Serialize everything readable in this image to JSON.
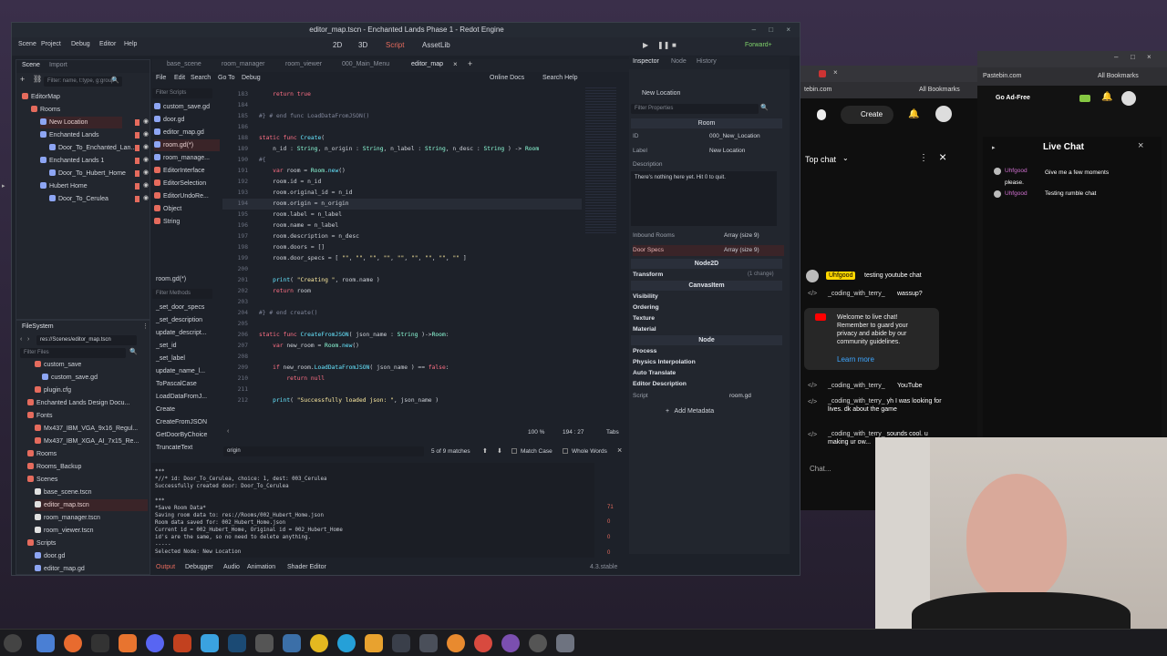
{
  "window": {
    "title": "editor_map.tscn - Enchanted Lands Phase 1 - Redot Engine"
  },
  "menu": [
    "Scene",
    "Project",
    "Debug",
    "Editor",
    "Help"
  ],
  "workspaces": [
    "2D",
    "3D",
    "Script",
    "AssetLib"
  ],
  "renderer": "Forward+",
  "scene_panel": {
    "tabs": [
      "Scene",
      "Import"
    ],
    "filter_placeholder": "Filter: name, t:type, g:group",
    "tree": [
      {
        "label": "EditorMap",
        "depth": 0
      },
      {
        "label": "Rooms",
        "depth": 1
      },
      {
        "label": "New Location",
        "depth": 2,
        "selected": true
      },
      {
        "label": "Enchanted Lands",
        "depth": 2
      },
      {
        "label": "Door_To_Enchanted_Lan...",
        "depth": 3
      },
      {
        "label": "Enchanted Lands 1",
        "depth": 2
      },
      {
        "label": "Door_To_Hubert_Home",
        "depth": 3
      },
      {
        "label": "Hubert Home",
        "depth": 2
      },
      {
        "label": "Door_To_Cerulea",
        "depth": 3
      }
    ]
  },
  "filesystem": {
    "title": "FileSystem",
    "path": "res://Scenes/editor_map.tscn",
    "filter_placeholder": "Filter Files",
    "items": [
      {
        "label": "custom_save",
        "depth": 2
      },
      {
        "label": "custom_save.gd",
        "depth": 3
      },
      {
        "label": "plugin.cfg",
        "depth": 2
      },
      {
        "label": "Enchanted Lands Design Docu...",
        "depth": 1
      },
      {
        "label": "Fonts",
        "depth": 1
      },
      {
        "label": "Mx437_IBM_VGA_9x16_Regul...",
        "depth": 2
      },
      {
        "label": "Mx437_IBM_XGA_AI_7x15_Re...",
        "depth": 2
      },
      {
        "label": "Rooms",
        "depth": 1
      },
      {
        "label": "Rooms_Backup",
        "depth": 1
      },
      {
        "label": "Scenes",
        "depth": 1
      },
      {
        "label": "base_scene.tscn",
        "depth": 2
      },
      {
        "label": "editor_map.tscn",
        "depth": 2,
        "selected": true
      },
      {
        "label": "room_manager.tscn",
        "depth": 2
      },
      {
        "label": "room_viewer.tscn",
        "depth": 2
      },
      {
        "label": "Scripts",
        "depth": 1
      },
      {
        "label": "door.gd",
        "depth": 2
      },
      {
        "label": "editor_map.gd",
        "depth": 2
      }
    ]
  },
  "script_tabs": [
    "base_scene",
    "room_manager",
    "room_viewer",
    "000_Main_Menu",
    "editor_map"
  ],
  "script_toolbar": {
    "file": "File",
    "edit": "Edit",
    "search": "Search",
    "goto": "Go To",
    "debug": "Debug",
    "online_docs": "Online Docs",
    "search_help": "Search Help"
  },
  "scripts_list": {
    "filter_placeholder": "Filter Scripts",
    "items": [
      "custom_save.gd",
      "door.gd",
      "editor_map.gd",
      "room.gd(*)",
      "room_manage...",
      "EditorInterface",
      "EditorSelection",
      "EditorUndoRe...",
      "Object",
      "String"
    ],
    "selected_index": 3,
    "current": "room.gd(*)"
  },
  "methods_list": {
    "filter_placeholder": "Filter Methods",
    "items": [
      "_set_door_specs",
      "_set_description",
      "update_descript...",
      "_set_id",
      "_set_label",
      "update_name_l...",
      "ToPascalCase",
      "LoadDataFromJ...",
      "Create",
      "CreateFromJSON",
      "GetDoorByChoice",
      "TruncateText"
    ]
  },
  "code": [
    {
      "n": "183",
      "t": "    return true",
      "k": "ret"
    },
    {
      "n": "184",
      "t": "",
      "k": ""
    },
    {
      "n": "185",
      "t": "#} # end func LoadDataFromJSON()",
      "k": "cm"
    },
    {
      "n": "186",
      "t": "",
      "k": ""
    },
    {
      "n": "188",
      "t": "static func Create(",
      "k": "func"
    },
    {
      "n": "189",
      "t": "    n_id : String, n_origin : String, n_label : String, n_desc : String ) -> Room",
      "k": ""
    },
    {
      "n": "190",
      "t": "#{",
      "k": "cm"
    },
    {
      "n": "191",
      "t": "    var room = Room.new()",
      "k": ""
    },
    {
      "n": "192",
      "t": "    room.id = n_id",
      "k": ""
    },
    {
      "n": "193",
      "t": "    room.original_id = n_id",
      "k": ""
    },
    {
      "n": "194",
      "t": "    room.origin = n_origin",
      "k": "",
      "hl": true
    },
    {
      "n": "195",
      "t": "    room.label = n_label",
      "k": ""
    },
    {
      "n": "196",
      "t": "    room.name = n_label",
      "k": ""
    },
    {
      "n": "197",
      "t": "    room.description = n_desc",
      "k": ""
    },
    {
      "n": "198",
      "t": "    room.doors = []",
      "k": ""
    },
    {
      "n": "199",
      "t": "    room.door_specs = [ \"\", \"\", \"\", \"\", \"\", \"\", \"\", \"\", \"\" ]",
      "k": ""
    },
    {
      "n": "200",
      "t": "",
      "k": ""
    },
    {
      "n": "201",
      "t": "    print( \"Creating \", room.name )",
      "k": ""
    },
    {
      "n": "202",
      "t": "    return room",
      "k": "ret"
    },
    {
      "n": "203",
      "t": "",
      "k": ""
    },
    {
      "n": "204",
      "t": "#} # end create()",
      "k": "cm"
    },
    {
      "n": "205",
      "t": "",
      "k": ""
    },
    {
      "n": "206",
      "t": "static func CreateFromJSON( json_name : String )->Room:",
      "k": "func"
    },
    {
      "n": "207",
      "t": "    var new_room = Room.new()",
      "k": ""
    },
    {
      "n": "208",
      "t": "",
      "k": ""
    },
    {
      "n": "209",
      "t": "    if new_room.LoadDataFromJSON( json_name ) == false:",
      "k": "if"
    },
    {
      "n": "210",
      "t": "        return null",
      "k": "ret"
    },
    {
      "n": "211",
      "t": "",
      "k": ""
    },
    {
      "n": "212",
      "t": "    print( \"Successfully loaded json: \", json_name )",
      "k": ""
    }
  ],
  "editor_status": {
    "zoom": "100 %",
    "pos": "194 :  27",
    "indent": "Tabs"
  },
  "find_bar": {
    "query": "origin",
    "matches": "5 of 9 matches",
    "match_case": "Match Case",
    "whole_words": "Whole Words"
  },
  "output": {
    "lines": [
      "***",
      "*//* id: Door_To_Cerulea, choice: 1, dest: 003_Cerulea",
      "Successfully created door: Door_To_Cerulea",
      "",
      "***",
      "*Save Room Data*",
      "Saving room data to: res://Rooms/002_Hubert_Home.json",
      "Room data saved for: 002_Hubert_Home.json",
      "Current id = 002_Hubert_Home, Original id = 002_Hubert_Home",
      "id's are the same, so no need to delete anything.",
      "-----",
      "Selected Node: New Location"
    ],
    "badges": [
      "71",
      "0",
      "0",
      "0"
    ]
  },
  "bottom_tabs": [
    "Output",
    "Debugger",
    "Audio",
    "Animation",
    "Shader Editor"
  ],
  "version": "4.3.stable",
  "inspector": {
    "tabs": [
      "Inspector",
      "Node",
      "History"
    ],
    "node": "New Location",
    "filter_placeholder": "Filter Properties",
    "class": "Room",
    "props": [
      {
        "k": "ID",
        "v": "000_New_Location"
      },
      {
        "k": "Label",
        "v": "New Location"
      },
      {
        "k": "Description",
        "v": ""
      }
    ],
    "description_text": "There's nothing here yet.  Hit 0 to quit.",
    "inbound_rooms": {
      "k": "Inbound Rooms",
      "v": "Array (size 9)"
    },
    "door_specs": {
      "k": "Door Specs",
      "v": "Array (size 9)"
    },
    "node2d": "Node2D",
    "transform": "Transform",
    "transform_changes": "(1 change)",
    "canvasitem": "CanvasItem",
    "canvas_sections": [
      "Visibility",
      "Ordering",
      "Texture",
      "Material"
    ],
    "node_class": "Node",
    "node_sections": [
      "Process",
      "Physics Interpolation",
      "Auto Translate",
      "Editor Description"
    ],
    "script_k": "Script",
    "script_v": "room.gd",
    "add_metadata": "Add Metadata"
  },
  "browser_left": {
    "url": "tebin.com",
    "bookmarks": "All Bookmarks",
    "create": "Create",
    "top_chat": "Top chat",
    "messages": [
      {
        "user": "Uhfgood",
        "text": "testing youtube chat",
        "owner": true
      },
      {
        "user": "_coding_with_terry_",
        "text": "wassup?"
      },
      {
        "user": "_coding_with_terry_",
        "text": "YouTube"
      },
      {
        "user": "_coding_with_terry_",
        "text": "yh I was looking for lives. dk about the game"
      },
      {
        "user": "_coding_with_terry_",
        "text": "sounds cool. u making ur ow..."
      }
    ],
    "welcome_text": "Welcome to live chat! Remember to guard your privacy and abide by our community guidelines.",
    "learn_more": "Learn more",
    "chat_placeholder": "Chat..."
  },
  "browser_right": {
    "url": "Pastebin.com",
    "bookmarks": "All Bookmarks",
    "go_ad_free": "Go Ad-Free",
    "live_chat": "Live Chat",
    "messages": [
      {
        "user": "Uhfgood",
        "text": "Give me a few moments please."
      },
      {
        "user": "Uhfgood",
        "text": "Testing rumble chat"
      }
    ]
  },
  "colors": {
    "accent": "#e56b5d",
    "godot_bg": "#1d2129",
    "panel_bg": "#22262e"
  }
}
